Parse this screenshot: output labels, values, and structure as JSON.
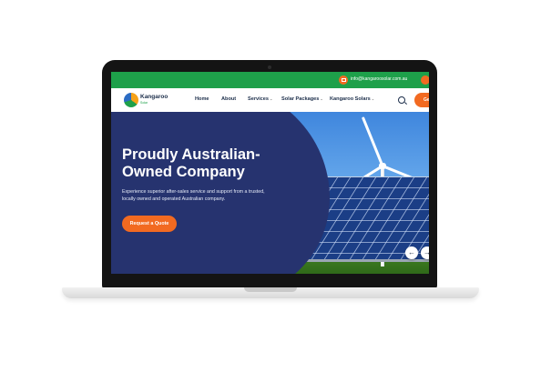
{
  "topbar": {
    "email": "info@kangaroosolar.com.au"
  },
  "navbar": {
    "logo_name": "Kangaroo",
    "logo_sub": "Solar",
    "items": [
      {
        "label": "Home",
        "has_dropdown": false
      },
      {
        "label": "About",
        "has_dropdown": false
      },
      {
        "label": "Services",
        "has_dropdown": true
      },
      {
        "label": "Solar Packages",
        "has_dropdown": true
      },
      {
        "label": "Kangaroo Solars",
        "has_dropdown": true
      }
    ],
    "cta_label": "Get",
    "dropdown_glyph": "⌄"
  },
  "hero": {
    "title": "Proudly Australian-Owned Company",
    "subtitle": "Experience superior after-sales service and support from a trusted, locally owned and operated Australian company.",
    "button_label": "Request a Quote",
    "prev_glyph": "←",
    "next_glyph": "→"
  },
  "colors": {
    "brand_green": "#1ea04a",
    "accent_orange": "#f26a21",
    "hero_navy": "#26336f"
  }
}
